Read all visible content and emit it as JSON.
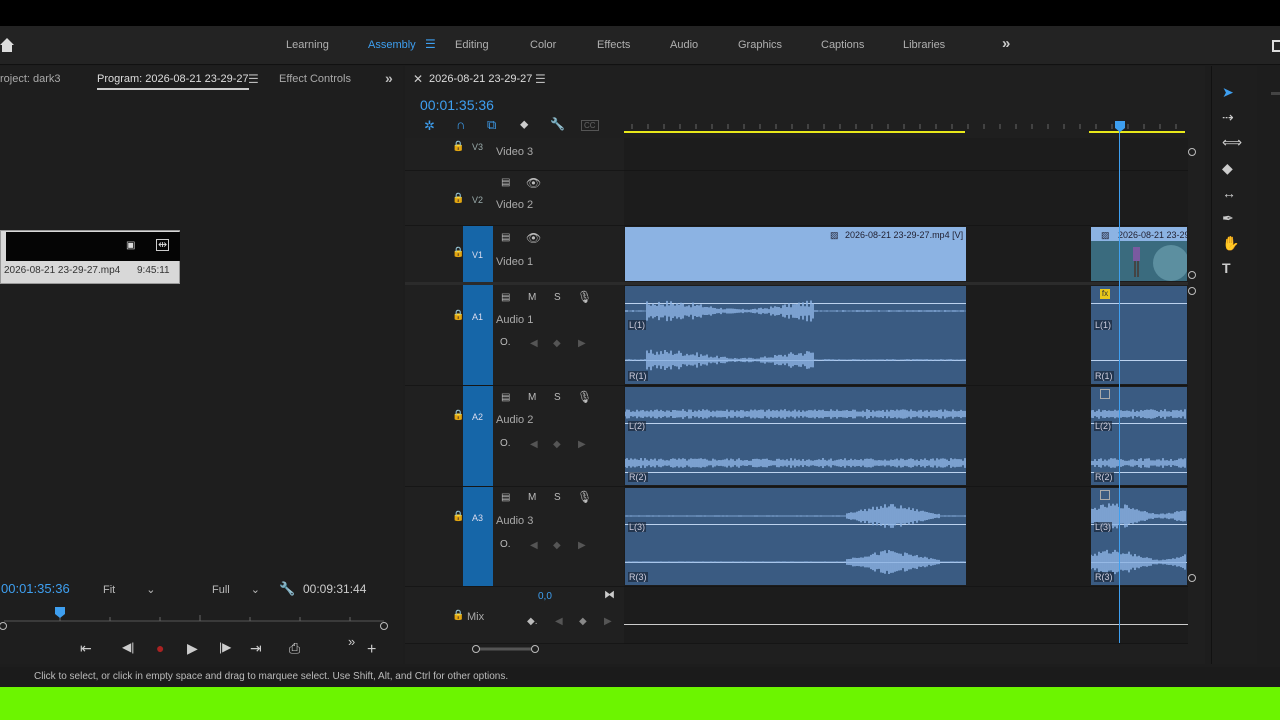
{
  "workspace_tabs": [
    "Learning",
    "Assembly",
    "Editing",
    "Color",
    "Effects",
    "Audio",
    "Graphics",
    "Captions",
    "Libraries"
  ],
  "active_workspace": "Assembly",
  "program_panel": {
    "tabs": [
      "roject: dark3",
      "Program: 2026-08-21 23-29-27",
      "Effect Controls"
    ],
    "clip_name": "2026-08-21 23-29-27.mp4",
    "clip_duration": "9:45:11",
    "current_timecode": "00:01:35:36",
    "fit_label": "Fit",
    "quality_label": "Full",
    "duration_timecode": "00:09:31:44"
  },
  "timeline_panel": {
    "sequence_tab": "2026-08-21 23-29-27",
    "playhead_timecode": "00:01:35:36",
    "tracks": {
      "v3": {
        "id": "V3",
        "name": "Video 3"
      },
      "v2": {
        "id": "V2",
        "name": "Video 2"
      },
      "v1": {
        "id": "V1",
        "name": "Video 1"
      },
      "a1": {
        "id": "A1",
        "name": "Audio 1"
      },
      "a2": {
        "id": "A2",
        "name": "Audio 2"
      },
      "a3": {
        "id": "A3",
        "name": "Audio 3"
      },
      "mix": {
        "name": "Mix",
        "value": "0,0"
      }
    },
    "video_clip_1": "2026-08-21 23-29-27.mp4 [V]",
    "video_clip_2": "2026-08-21 23-29",
    "channel_labels": {
      "a1": [
        "L(1)",
        "R(1)"
      ],
      "a2": [
        "L(2)",
        "R(2)"
      ],
      "a3": [
        "L(3)",
        "R(3)"
      ]
    },
    "track_buttons": {
      "mute": "M",
      "solo": "S"
    }
  },
  "status_text": "Click to select, or click in empty space and drag to marquee select. Use Shift, Alt, and Ctrl for other options.",
  "colors": {
    "accent_blue": "#3e9ff0",
    "video_clip": "#8cb3e3",
    "audio_clip": "#3a5b82",
    "track_target": "#1666a8",
    "work_area_yellow": "#e8e81a",
    "status_green": "#6cf500"
  }
}
